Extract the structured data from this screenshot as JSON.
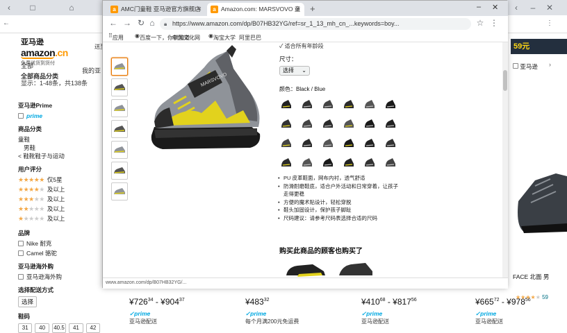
{
  "bg_browser": {
    "url_hint": "",
    "zoom_icon": "window-controls"
  },
  "amazon_header": {
    "logo_cn": "亚马逊",
    "logo_brand": "amazon",
    "logo_tld": ".cn",
    "logo_sub": "免费送货到货付",
    "nav_left_1": "全部",
    "nav_left_2": "全部商品分类",
    "nav_left_3": "我的亚",
    "deliver": "送至"
  },
  "results": {
    "summary": "显示：1-48条，共138条"
  },
  "sidebar": {
    "prime_heading": "亚马逊Prime",
    "prime_label": "prime",
    "category_heading": "商品分类",
    "category_1": "童鞋",
    "category_2": "男鞋",
    "category_3": "< 鞋靴鞋子与运动",
    "rating_heading": "用户评分",
    "rating_rows": [
      {
        "filled": 5,
        "label": "仅5星"
      },
      {
        "filled": 4,
        "label": "及以上"
      },
      {
        "filled": 3,
        "label": "及以上"
      },
      {
        "filled": 2,
        "label": "及以上"
      },
      {
        "filled": 1,
        "label": "及以上"
      }
    ],
    "brand_heading": "品牌",
    "brand_1": "Nike 耐克",
    "brand_2": "Camel 骆驼",
    "ship_heading": "亚马逊海外购",
    "ship_label": "亚马逊海外购",
    "sort_heading": "选择配送方式",
    "sort_btn": "选择",
    "size_heading": "鞋码",
    "sizes": [
      "31",
      "40",
      "40.5",
      "41",
      "42"
    ]
  },
  "bg_prices": [
    {
      "main": "¥726",
      "frac": "34",
      "range": "- ¥904",
      "range_frac": "37",
      "prime": "prime",
      "sub": "亚马逊配送"
    },
    {
      "main": "¥483",
      "frac": "32",
      "range": "",
      "range_frac": "",
      "prime": "prime",
      "sub": "每个月满200元免运费"
    },
    {
      "main": "¥410",
      "frac": "68",
      "range": "- ¥817",
      "range_frac": "56",
      "prime": "prime",
      "sub": "亚马逊配送"
    },
    {
      "main": "¥665",
      "frac": "72",
      "range": "- ¥978",
      "range_frac": "56",
      "prime": "prime",
      "sub": "亚马逊配送"
    }
  ],
  "bg_right": {
    "banner": "59元",
    "label_1": "亚马逊",
    "face": "FACE 北面 男",
    "rating_count": "59"
  },
  "fg_window": {
    "tab1_title": "AMC门童鞋 亚马逊官方旗舰店",
    "tab2_title": "Amazon.com: MARSVOVO 童",
    "url": "https://www.amazon.com/dp/B07HB32YG/ref=sr_1_13_mh_cn_...keywords=boy...",
    "bookmark_1": "应用",
    "bookmark_2": "百度一下，你就知道",
    "bookmark_3": "中国文化网",
    "bookmark_4": "淘宝大学",
    "bookmark_5": "阿里巴巴",
    "status": "www.amazon.com/dp/B07HB32YG/..."
  },
  "product": {
    "delivery": "✓ 适合所有年龄段",
    "size_label": "尺寸：",
    "size_select": "选择",
    "color_label": "颜色：Black / Blue",
    "bullets": [
      "PU 皮革鞋面，网布内衬，透气舒适",
      "防滑耐磨鞋底，适合户外活动和日常穿着，让孩子走得更稳",
      "方便的魔术贴设计，轻松穿脱",
      "鞋头加固设计，保护孩子脚趾",
      "尺码建议：请参考尺码表选择合适的尺码"
    ],
    "related_heading": "购买此商品的顾客也购买了"
  }
}
